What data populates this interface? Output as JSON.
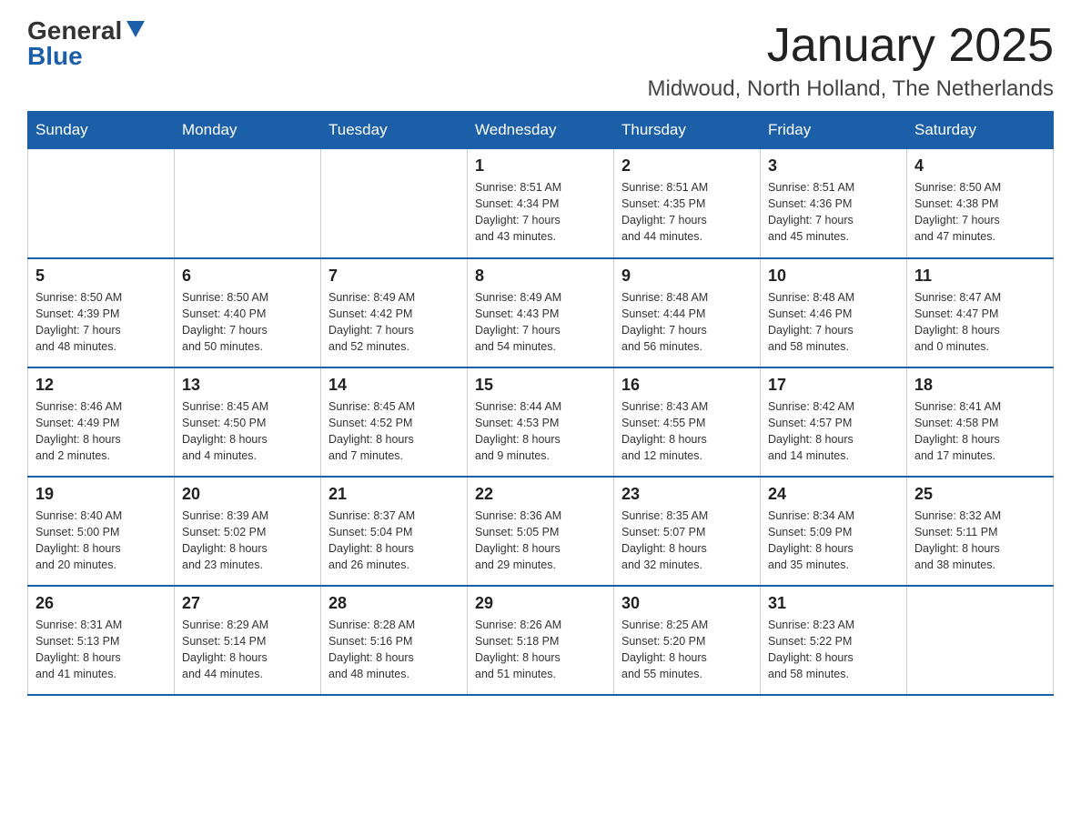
{
  "logo": {
    "general": "General",
    "blue": "Blue"
  },
  "title": {
    "month_year": "January 2025",
    "location": "Midwoud, North Holland, The Netherlands"
  },
  "headers": [
    "Sunday",
    "Monday",
    "Tuesday",
    "Wednesday",
    "Thursday",
    "Friday",
    "Saturday"
  ],
  "weeks": [
    [
      {
        "day": "",
        "info": ""
      },
      {
        "day": "",
        "info": ""
      },
      {
        "day": "",
        "info": ""
      },
      {
        "day": "1",
        "info": "Sunrise: 8:51 AM\nSunset: 4:34 PM\nDaylight: 7 hours\nand 43 minutes."
      },
      {
        "day": "2",
        "info": "Sunrise: 8:51 AM\nSunset: 4:35 PM\nDaylight: 7 hours\nand 44 minutes."
      },
      {
        "day": "3",
        "info": "Sunrise: 8:51 AM\nSunset: 4:36 PM\nDaylight: 7 hours\nand 45 minutes."
      },
      {
        "day": "4",
        "info": "Sunrise: 8:50 AM\nSunset: 4:38 PM\nDaylight: 7 hours\nand 47 minutes."
      }
    ],
    [
      {
        "day": "5",
        "info": "Sunrise: 8:50 AM\nSunset: 4:39 PM\nDaylight: 7 hours\nand 48 minutes."
      },
      {
        "day": "6",
        "info": "Sunrise: 8:50 AM\nSunset: 4:40 PM\nDaylight: 7 hours\nand 50 minutes."
      },
      {
        "day": "7",
        "info": "Sunrise: 8:49 AM\nSunset: 4:42 PM\nDaylight: 7 hours\nand 52 minutes."
      },
      {
        "day": "8",
        "info": "Sunrise: 8:49 AM\nSunset: 4:43 PM\nDaylight: 7 hours\nand 54 minutes."
      },
      {
        "day": "9",
        "info": "Sunrise: 8:48 AM\nSunset: 4:44 PM\nDaylight: 7 hours\nand 56 minutes."
      },
      {
        "day": "10",
        "info": "Sunrise: 8:48 AM\nSunset: 4:46 PM\nDaylight: 7 hours\nand 58 minutes."
      },
      {
        "day": "11",
        "info": "Sunrise: 8:47 AM\nSunset: 4:47 PM\nDaylight: 8 hours\nand 0 minutes."
      }
    ],
    [
      {
        "day": "12",
        "info": "Sunrise: 8:46 AM\nSunset: 4:49 PM\nDaylight: 8 hours\nand 2 minutes."
      },
      {
        "day": "13",
        "info": "Sunrise: 8:45 AM\nSunset: 4:50 PM\nDaylight: 8 hours\nand 4 minutes."
      },
      {
        "day": "14",
        "info": "Sunrise: 8:45 AM\nSunset: 4:52 PM\nDaylight: 8 hours\nand 7 minutes."
      },
      {
        "day": "15",
        "info": "Sunrise: 8:44 AM\nSunset: 4:53 PM\nDaylight: 8 hours\nand 9 minutes."
      },
      {
        "day": "16",
        "info": "Sunrise: 8:43 AM\nSunset: 4:55 PM\nDaylight: 8 hours\nand 12 minutes."
      },
      {
        "day": "17",
        "info": "Sunrise: 8:42 AM\nSunset: 4:57 PM\nDaylight: 8 hours\nand 14 minutes."
      },
      {
        "day": "18",
        "info": "Sunrise: 8:41 AM\nSunset: 4:58 PM\nDaylight: 8 hours\nand 17 minutes."
      }
    ],
    [
      {
        "day": "19",
        "info": "Sunrise: 8:40 AM\nSunset: 5:00 PM\nDaylight: 8 hours\nand 20 minutes."
      },
      {
        "day": "20",
        "info": "Sunrise: 8:39 AM\nSunset: 5:02 PM\nDaylight: 8 hours\nand 23 minutes."
      },
      {
        "day": "21",
        "info": "Sunrise: 8:37 AM\nSunset: 5:04 PM\nDaylight: 8 hours\nand 26 minutes."
      },
      {
        "day": "22",
        "info": "Sunrise: 8:36 AM\nSunset: 5:05 PM\nDaylight: 8 hours\nand 29 minutes."
      },
      {
        "day": "23",
        "info": "Sunrise: 8:35 AM\nSunset: 5:07 PM\nDaylight: 8 hours\nand 32 minutes."
      },
      {
        "day": "24",
        "info": "Sunrise: 8:34 AM\nSunset: 5:09 PM\nDaylight: 8 hours\nand 35 minutes."
      },
      {
        "day": "25",
        "info": "Sunrise: 8:32 AM\nSunset: 5:11 PM\nDaylight: 8 hours\nand 38 minutes."
      }
    ],
    [
      {
        "day": "26",
        "info": "Sunrise: 8:31 AM\nSunset: 5:13 PM\nDaylight: 8 hours\nand 41 minutes."
      },
      {
        "day": "27",
        "info": "Sunrise: 8:29 AM\nSunset: 5:14 PM\nDaylight: 8 hours\nand 44 minutes."
      },
      {
        "day": "28",
        "info": "Sunrise: 8:28 AM\nSunset: 5:16 PM\nDaylight: 8 hours\nand 48 minutes."
      },
      {
        "day": "29",
        "info": "Sunrise: 8:26 AM\nSunset: 5:18 PM\nDaylight: 8 hours\nand 51 minutes."
      },
      {
        "day": "30",
        "info": "Sunrise: 8:25 AM\nSunset: 5:20 PM\nDaylight: 8 hours\nand 55 minutes."
      },
      {
        "day": "31",
        "info": "Sunrise: 8:23 AM\nSunset: 5:22 PM\nDaylight: 8 hours\nand 58 minutes."
      },
      {
        "day": "",
        "info": ""
      }
    ]
  ]
}
